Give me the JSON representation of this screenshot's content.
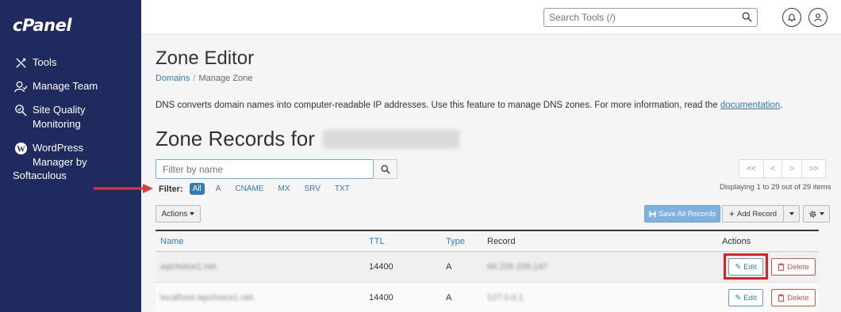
{
  "sidebar": {
    "logo": "cPanel",
    "items": [
      {
        "label": "Tools",
        "icon": "tools-icon"
      },
      {
        "label": "Manage Team",
        "icon": "manage-team-icon"
      },
      {
        "label": "Site Quality\nMonitoring",
        "icon": "site-quality-icon"
      },
      {
        "label": "WordPress\nManager by",
        "icon": "wordpress-icon"
      }
    ],
    "wp_extra": "Softaculous"
  },
  "topbar": {
    "search_placeholder": "Search Tools (/)"
  },
  "page": {
    "title": "Zone Editor",
    "breadcrumb": {
      "link": "Domains",
      "separator": "/",
      "current": "Manage Zone"
    },
    "description": "DNS converts domain names into computer-readable IP addresses. Use this feature to manage DNS zones. For more information, read the ",
    "description_link": "documentation",
    "description_end": "."
  },
  "zone": {
    "title": "Zone Records for",
    "filter_placeholder": "Filter by name",
    "filter_label": "Filter:",
    "filter_chips": [
      "All",
      "A",
      "CNAME",
      "MX",
      "SRV",
      "TXT"
    ],
    "active_filter": "All",
    "pager": [
      "<<",
      "<",
      ">",
      ">>"
    ],
    "displaying": "Displaying 1 to 29 out of 29 items",
    "actions_label": "Actions",
    "save_all_label": "Save All Records",
    "add_record_label": "Add Record"
  },
  "table": {
    "headers": {
      "name": "Name",
      "ttl": "TTL",
      "type": "Type",
      "record": "Record",
      "actions": "Actions"
    },
    "rows": [
      {
        "name": "wpchoice1.net.",
        "ttl": "14400",
        "type": "A",
        "record": "66.226.209.147",
        "edit": "Edit",
        "delete": "Delete"
      },
      {
        "name": "localhost.wpchoice1.net.",
        "ttl": "14400",
        "type": "A",
        "record": "127.0.0.1",
        "edit": "Edit",
        "delete": "Delete"
      }
    ]
  },
  "colors": {
    "sidebar_bg": "#1f2a5e",
    "link_blue": "#337ab7",
    "danger_red": "#d9534f",
    "highlight_red": "#e02020",
    "save_button_blue": "#7fb0de"
  }
}
